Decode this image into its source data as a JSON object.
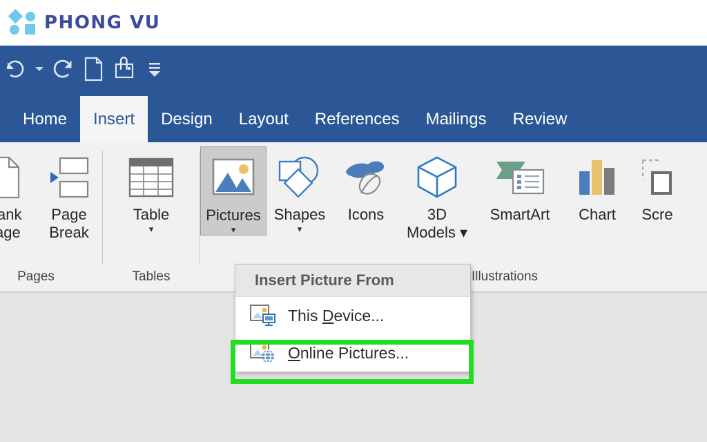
{
  "brand": {
    "name": "PHONG VU",
    "logo_color": "#6FC9E8",
    "text_color": "#3B4C9E"
  },
  "ribbon": {
    "accent_color": "#2B5797",
    "quick_access": [
      {
        "name": "undo-icon",
        "label": "Undo"
      },
      {
        "name": "undo-dropdown-icon",
        "label": "Undo options"
      },
      {
        "name": "redo-icon",
        "label": "Redo"
      },
      {
        "name": "new-document-icon",
        "label": "New"
      },
      {
        "name": "email-attachment-icon",
        "label": "Email"
      },
      {
        "name": "customize-quick-access-toolbar-icon",
        "label": "Customize Quick Access Toolbar"
      }
    ],
    "tabs": [
      {
        "label": "Home",
        "active": false
      },
      {
        "label": "Insert",
        "active": true
      },
      {
        "label": "Design",
        "active": false
      },
      {
        "label": "Layout",
        "active": false
      },
      {
        "label": "References",
        "active": false
      },
      {
        "label": "Mailings",
        "active": false
      },
      {
        "label": "Review",
        "active": false
      }
    ],
    "groups": [
      {
        "label": "Pages",
        "buttons": [
          {
            "label": "Blank\nPage",
            "caret": "",
            "selected": false
          },
          {
            "label": "Page\nBreak",
            "caret": "",
            "selected": false
          }
        ]
      },
      {
        "label": "Tables",
        "buttons": [
          {
            "label": "Table",
            "caret": "▾",
            "selected": false
          }
        ]
      },
      {
        "label": "Illustrations",
        "buttons": [
          {
            "label": "Pictures",
            "caret": "▾",
            "selected": true
          },
          {
            "label": "Shapes",
            "caret": "▾",
            "selected": false
          },
          {
            "label": "Icons",
            "caret": "",
            "selected": false
          },
          {
            "label": "3D\nModels ▾",
            "caret": "",
            "selected": false
          },
          {
            "label": "SmartArt",
            "caret": "",
            "selected": false
          },
          {
            "label": "Chart",
            "caret": "",
            "selected": false
          },
          {
            "label": "Scre",
            "caret": "",
            "selected": false
          }
        ]
      }
    ]
  },
  "menu": {
    "header": "Insert Picture From",
    "items": [
      {
        "icon": "picture-device-icon",
        "pre": "This ",
        "accel": "D",
        "post": "evice...",
        "highlighted": false
      },
      {
        "icon": "picture-online-icon",
        "pre": "",
        "accel": "O",
        "post": "nline Pictures...",
        "highlighted": true
      }
    ]
  },
  "highlight": {
    "color": "#22DD22",
    "target": "Online Pictures..."
  }
}
